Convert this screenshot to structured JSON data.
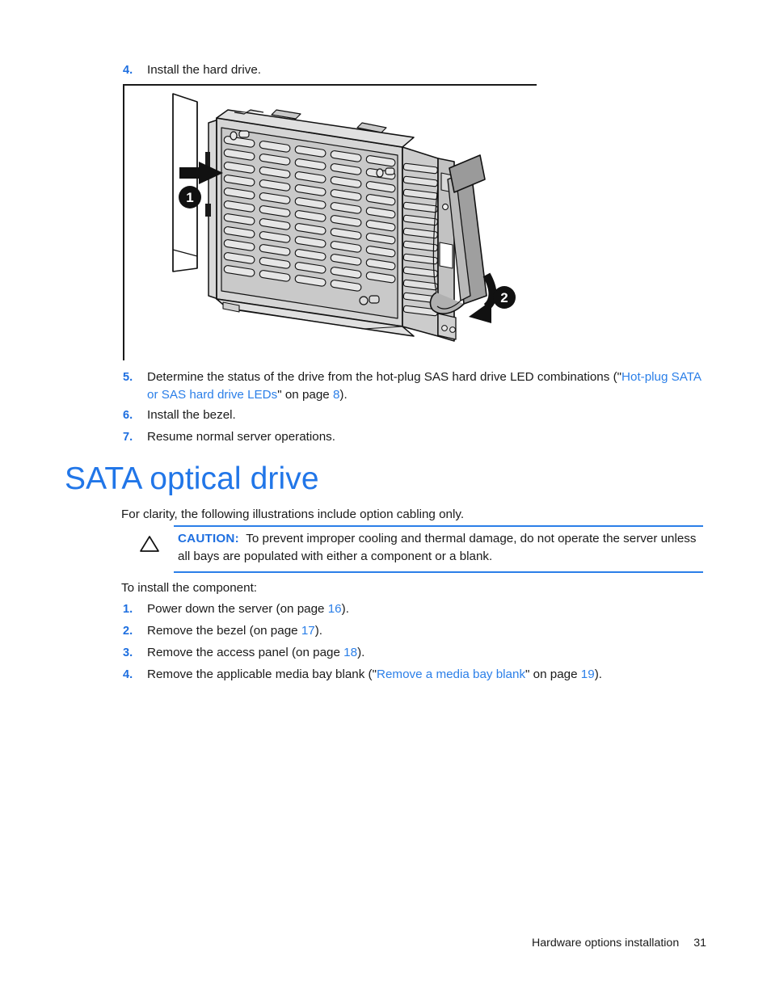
{
  "document": {
    "title": "SATA optical drive",
    "footer": {
      "chapter": "Hardware options installation",
      "page_number": "31"
    }
  },
  "colors": {
    "heading_blue": "#2176E8",
    "link_blue": "#2B7FE8",
    "number_blue": "#1E6FE0",
    "body_black": "#1a1a1a",
    "rule_black": "#1a1a1a"
  },
  "hard_drive_steps": {
    "step4": {
      "number": "4.",
      "text": "Install the hard drive."
    },
    "step5": {
      "number": "5.",
      "text_part1": "Determine the status of the drive from the hot-plug SAS hard drive LED combinations (\"",
      "link": "Hot-plug SATA or SAS hard drive LEDs",
      "text_part2": "\" on page ",
      "page": "8",
      "text_part3": ")."
    },
    "step6": {
      "number": "6.",
      "text": "Install the bezel."
    },
    "step7": {
      "number": "7.",
      "text": "Resume normal server operations."
    }
  },
  "figure": {
    "name": "hard-drive-installation-illustration",
    "callouts": [
      {
        "label": "1",
        "meaning": "slide-drive-into-bay"
      },
      {
        "label": "2",
        "meaning": "close-drive-handle"
      }
    ]
  },
  "section": {
    "heading": "SATA optical drive",
    "intro": "For clarity, the following illustrations include option cabling only.",
    "caution": {
      "icon": "warning-triangle-icon",
      "label": "CAUTION:",
      "text": "To prevent improper cooling and thermal damage, do not operate the server unless all bays are populated with either a component or a blank."
    },
    "install_intro": "To install the component:",
    "steps": [
      {
        "number": "1.",
        "text_part1": "Power down the server (on page ",
        "page": "16",
        "text_part2": ")."
      },
      {
        "number": "2.",
        "text_part1": "Remove the bezel (on page ",
        "page": "17",
        "text_part2": ")."
      },
      {
        "number": "3.",
        "text_part1": "Remove the access panel (on page ",
        "page": "18",
        "text_part2": ")."
      },
      {
        "number": "4.",
        "text_part1": "Remove the applicable media bay blank (\"",
        "link": "Remove a media bay blank",
        "text_part2": "\" on page ",
        "page": "19",
        "text_part3": ")."
      }
    ]
  }
}
